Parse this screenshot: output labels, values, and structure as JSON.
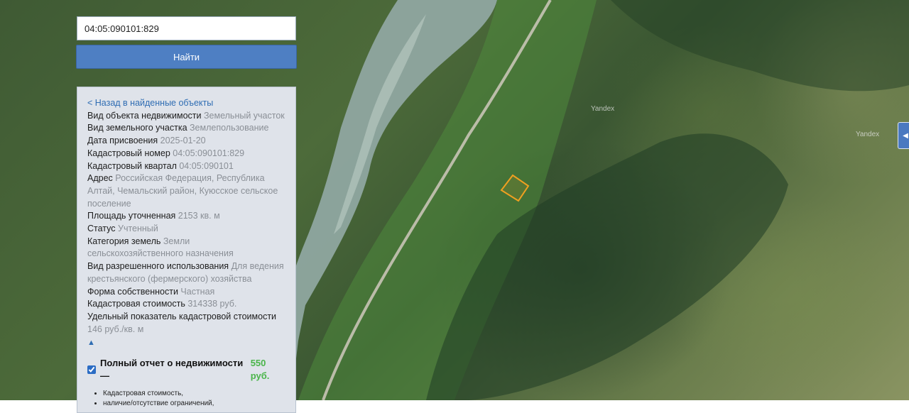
{
  "search": {
    "value": "04:05:090101:829"
  },
  "search_button": {
    "label": "Найти"
  },
  "panel": {
    "back_link": "< Назад в найденные объекты",
    "fields": [
      {
        "label": "Вид объекта недвижимости",
        "value": "Земельный участок"
      },
      {
        "label": "Вид земельного участка",
        "value": "Землепользование"
      },
      {
        "label": "Дата присвоения",
        "value": "2025-01-20"
      },
      {
        "label": "Кадастровый номер",
        "value": "04:05:090101:829"
      },
      {
        "label": "Кадастровый квартал",
        "value": "04:05:090101"
      },
      {
        "label": "Адрес",
        "value": "Российская Федерация, Республика Алтай, Чемальский район, Куюсское сельское поселение"
      },
      {
        "label": "Площадь уточненная",
        "value": "2153 кв. м"
      },
      {
        "label": "Статус",
        "value": "Учтенный"
      },
      {
        "label": "Категория земель",
        "value": "Земли сельскохозяйственного назначения"
      },
      {
        "label": "Вид разрешенного использования",
        "value": "Для ведения крестьянского (фермерского) хозяйства"
      },
      {
        "label": "Форма собственности",
        "value": "Частная"
      },
      {
        "label": "Кадастровая стоимость",
        "value": "314338 руб."
      },
      {
        "label": "Удельный показатель кадастровой стоимости",
        "value": "146 руб./кв. м"
      }
    ],
    "collapse_symbol": "▲",
    "report": {
      "label": "Полный отчет о недвижимости —",
      "price": "550 руб.",
      "checked": true
    },
    "bullets": [
      "Кадастровая стоимость,",
      "наличие/отсутствие ограничений,"
    ]
  },
  "map": {
    "watermarks": [
      "Yandex",
      "Yandex"
    ],
    "parcel_color": "#f0a020",
    "river_color": "#8fa7a0",
    "road_color": "#c8c4b6"
  }
}
